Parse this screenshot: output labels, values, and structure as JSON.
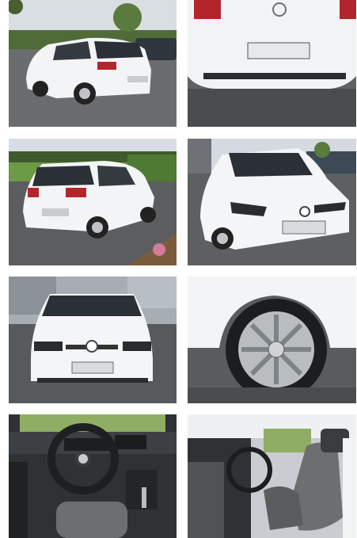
{
  "gallery": {
    "photos": [
      {
        "subject": "rear-three-quarter-left",
        "plate_text": ""
      },
      {
        "subject": "rear-close-up",
        "plate_text": ""
      },
      {
        "subject": "rear-three-quarter-left-parking",
        "plate_text": ""
      },
      {
        "subject": "front-three-quarter-left",
        "plate_text": ""
      },
      {
        "subject": "front-view",
        "plate_text": ""
      },
      {
        "subject": "alloy-wheel",
        "plate_text": ""
      },
      {
        "subject": "dashboard-interior",
        "plate_text": ""
      },
      {
        "subject": "front-seats-interior",
        "plate_text": ""
      }
    ]
  },
  "colors": {
    "car_body": "#f4f5f6",
    "window": "#2b3036",
    "tail_light": "#b3252b",
    "asphalt": "#5b5d5f",
    "sky": "#d7dde3",
    "grass": "#5e8a3c",
    "interior_dark": "#2f3134",
    "seat_fabric": "#6c6e70"
  }
}
